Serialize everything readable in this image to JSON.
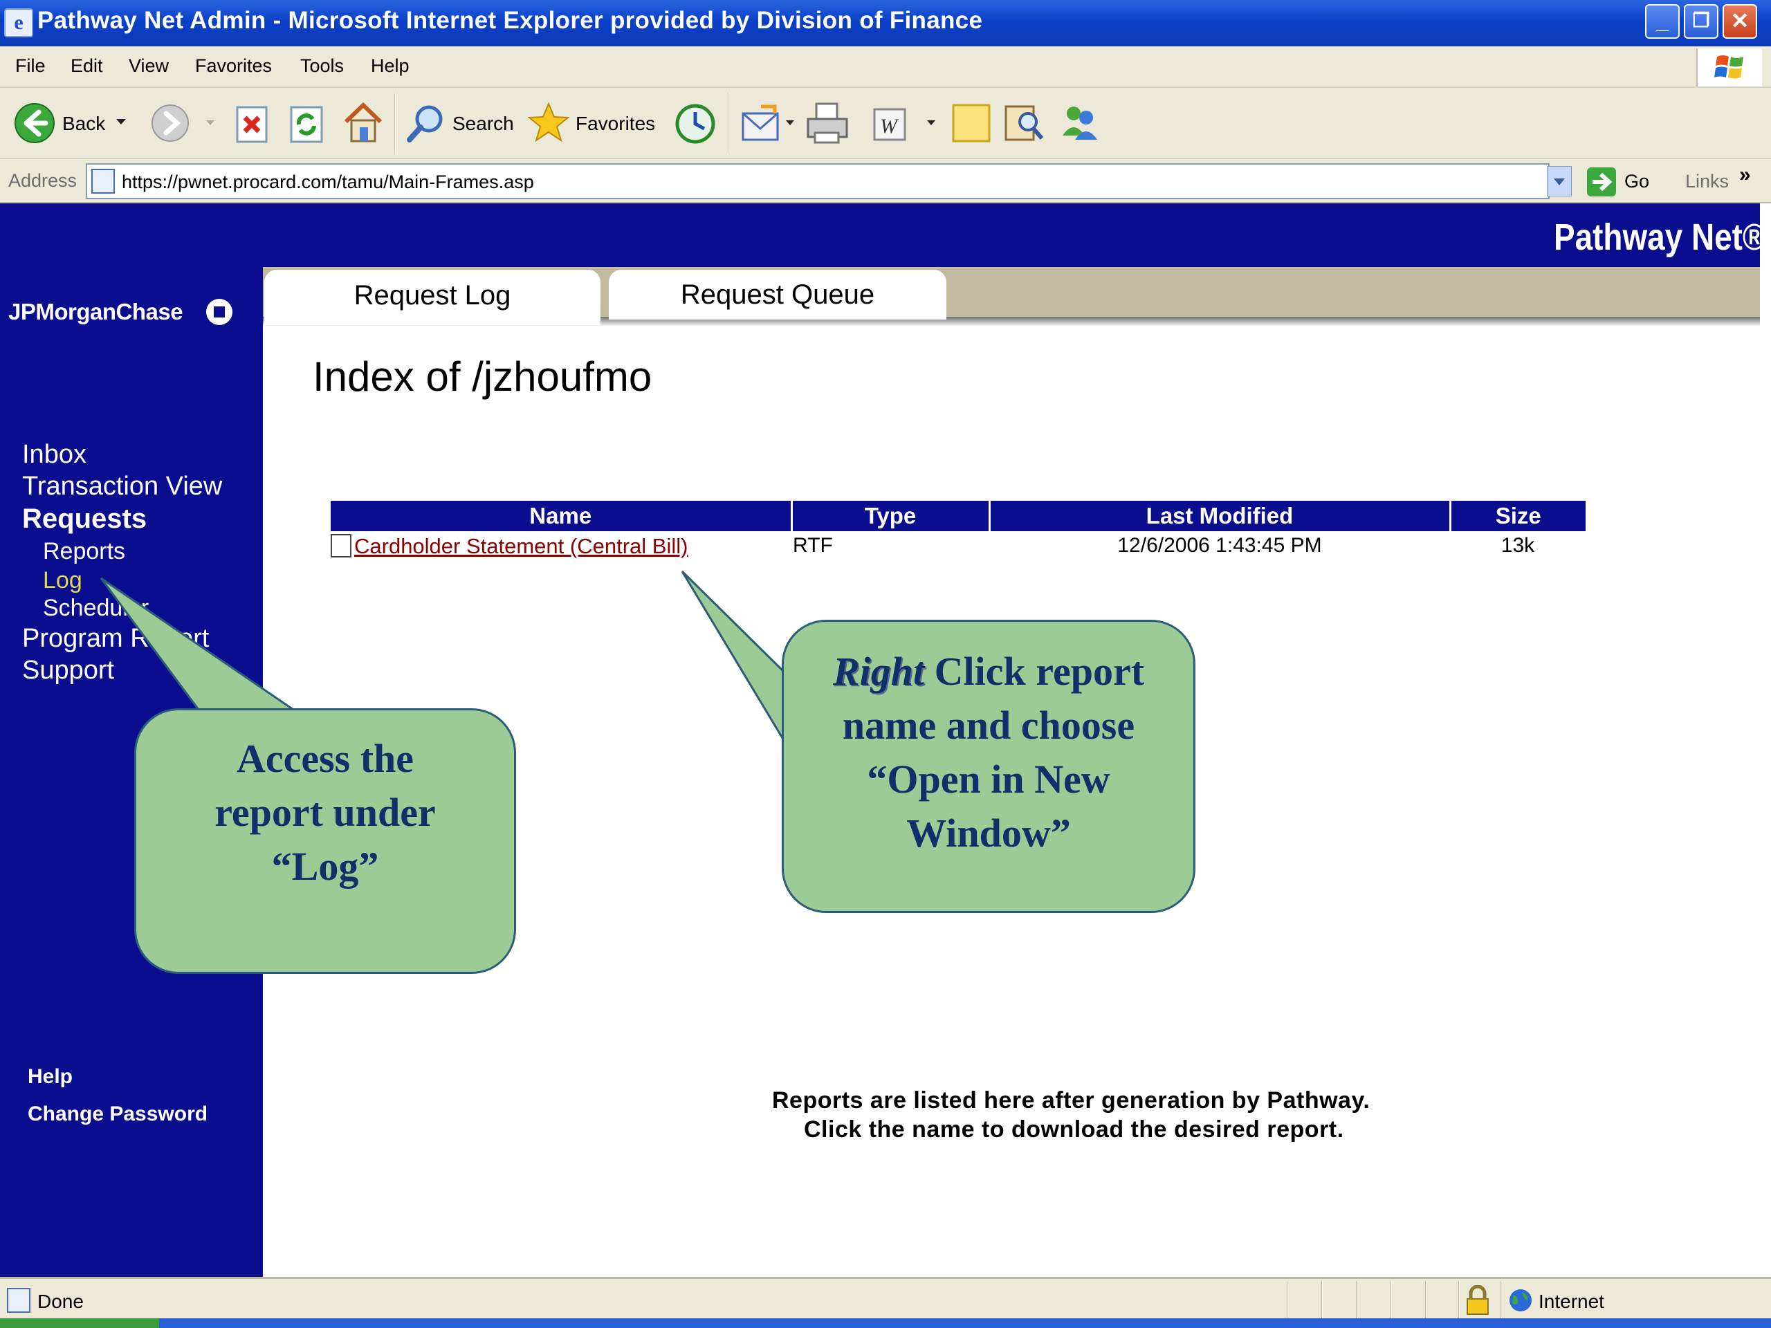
{
  "window": {
    "title": "Pathway Net Admin - Microsoft Internet Explorer provided by Division of Finance",
    "minimize_glyph": "_",
    "restore_glyph": "❐",
    "close_glyph": "✕"
  },
  "menu": [
    "File",
    "Edit",
    "View",
    "Favorites",
    "Tools",
    "Help"
  ],
  "toolbar": {
    "back_label": "Back",
    "search_label": "Search",
    "favorites_label": "Favorites"
  },
  "address": {
    "label": "Address",
    "url": "https://pwnet.procard.com/tamu/Main-Frames.asp",
    "go_label": "Go",
    "links_label": "Links"
  },
  "header": {
    "brand": "Pathway Net®"
  },
  "sidebar": {
    "logo": "JPMorganChase",
    "nav": {
      "inbox": "Inbox",
      "transaction_view": "Transaction View",
      "requests": "Requests",
      "reports": "Reports",
      "log": "Log",
      "scheduler": "Scheduler",
      "program_report": "Program Report",
      "support": "Support"
    },
    "bottom": {
      "help": "Help",
      "change_password": "Change Password"
    }
  },
  "tabs": {
    "request_log": "Request Log",
    "request_queue": "Request Queue"
  },
  "main": {
    "title": "Index of /jzhoufmo",
    "table": {
      "headers": [
        "Name",
        "Type",
        "Last Modified",
        "Size"
      ],
      "rows": [
        {
          "name": "Cardholder Statement (Central Bill)",
          "type": "RTF",
          "last_modified": "12/6/2006 1:43:45 PM",
          "size": "13k"
        }
      ]
    },
    "note_line1": "Reports are listed here after generation by Pathway.",
    "note_line2": "Click the name to download the desired report."
  },
  "callouts": {
    "left": {
      "line1": "Access the",
      "line2": "report under",
      "line3": "“Log”"
    },
    "right": {
      "emphasis": "Right",
      "line1_rest": " Click report",
      "line2": "name and choose",
      "line3": "“Open in New",
      "line4": "Window”"
    }
  },
  "status": {
    "text": "Done",
    "zone": "Internet"
  },
  "colors": {
    "page_navy": "#0a0d8e",
    "callout_green": "#9ccb96",
    "callout_text": "#10306a",
    "link": "#8b0000",
    "active_nav": "#e0d84a"
  },
  "icons": [
    "ie-page-icon",
    "windows-flag-icon",
    "back-arrow-icon",
    "forward-arrow-icon",
    "stop-icon",
    "refresh-icon",
    "home-icon",
    "search-icon",
    "favorites-star-icon",
    "history-icon",
    "mail-icon",
    "print-icon",
    "edit-word-icon",
    "discuss-note-icon",
    "research-icon",
    "messenger-icon",
    "go-arrow-icon",
    "lock-icon",
    "globe-icon",
    "document-icon"
  ]
}
